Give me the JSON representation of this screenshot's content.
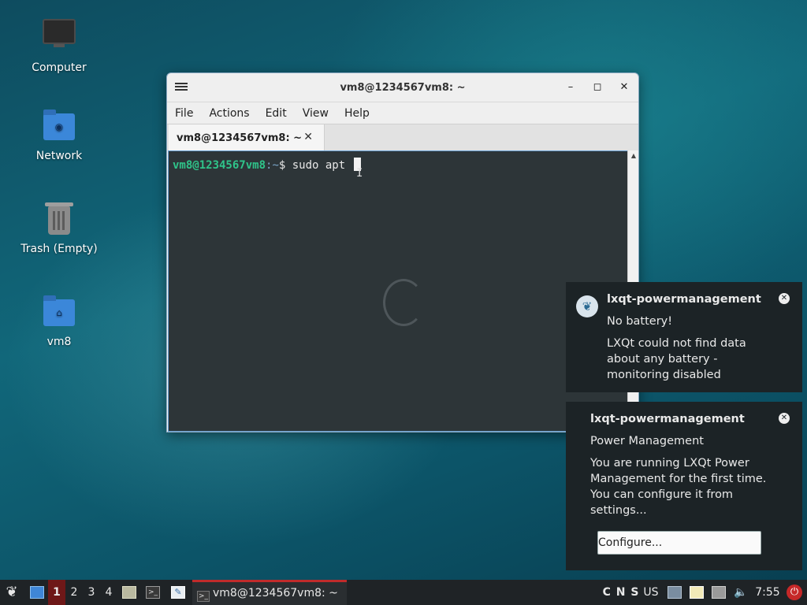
{
  "desktop": {
    "icons": [
      {
        "label": "Computer"
      },
      {
        "label": "Network"
      },
      {
        "label": "Trash (Empty)"
      },
      {
        "label": "vm8"
      }
    ]
  },
  "window": {
    "title": "vm8@1234567vm8: ~",
    "menu": [
      "File",
      "Actions",
      "Edit",
      "View",
      "Help"
    ],
    "tab_label": "vm8@1234567vm8: ~",
    "terminal": {
      "prompt_user": "vm8@1234567vm8",
      "prompt_path": ":~",
      "prompt_symbol": "$ ",
      "command": "sudo apt "
    }
  },
  "notifications": [
    {
      "title": "lxqt-powermanagement",
      "summary": "No battery!",
      "body": "LXQt could not find data about any battery - monitoring disabled"
    },
    {
      "title": "lxqt-powermanagement",
      "summary": "Power Management",
      "body": "You are running LXQt Power Management for the first time. You can configure it from settings...",
      "button": "Configure..."
    }
  ],
  "taskbar": {
    "desktops": [
      "1",
      "2",
      "3",
      "4"
    ],
    "active_desktop": "1",
    "task_label": "vm8@1234567vm8: ~",
    "keyboard_indicators": "C N S",
    "keyboard_layout": "US",
    "clock": "7:55"
  },
  "colors": {
    "prompt_user": "#2fc48a",
    "terminal_bg": "#2d3538",
    "taskbar_bg": "#1f2326",
    "active_desktop": "#6e1818",
    "notification_bg": "#1c2326"
  }
}
